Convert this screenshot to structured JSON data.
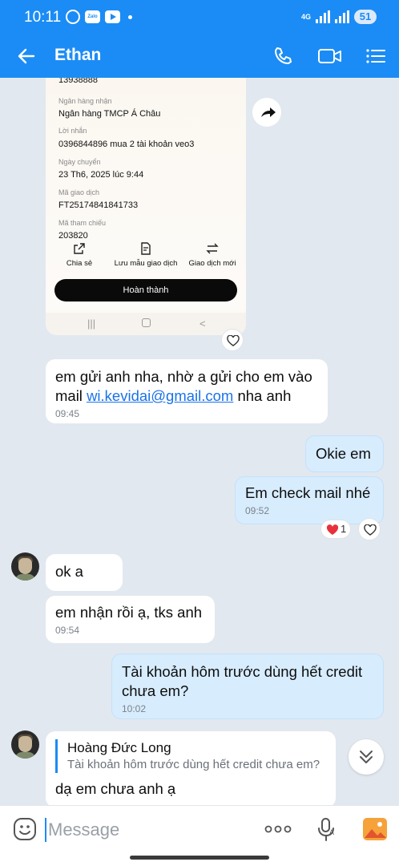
{
  "status_bar": {
    "time": "10:11",
    "zalo_badge": "Zalo",
    "network": "4G",
    "battery": "51"
  },
  "header": {
    "title": "Ethan",
    "icons": [
      "back-arrow-icon",
      "phone-icon",
      "video-call-icon",
      "menu-icon"
    ],
    "color": "#1b8cf5"
  },
  "receipt": {
    "top_value": "13938888",
    "fields": [
      {
        "label": "Ngân hàng nhận",
        "value": "Ngân hàng TMCP Á Châu"
      },
      {
        "label": "Lời nhắn",
        "value": "0396844896 mua 2 tài khoản veo3"
      },
      {
        "label": "Ngày chuyển",
        "value": "23 Th6, 2025 lúc 9:44"
      },
      {
        "label": "Mã giao dịch",
        "value": "FT25174841841733"
      },
      {
        "label": "Mã tham chiếu",
        "value": "203820"
      }
    ],
    "actions": [
      "Chia sẻ",
      "Lưu mẫu giao dịch",
      "Giao dịch mới"
    ],
    "done_button": "Hoàn thành"
  },
  "messages": [
    {
      "id": "m1",
      "direction": "in",
      "text_before": "em gửi anh nha, nhờ a gửi cho em vào mail ",
      "link": "wi.kevidai@gmail.com",
      "text_after": " nha anh",
      "time": "09:45"
    },
    {
      "id": "m2",
      "direction": "out",
      "text": "Okie em"
    },
    {
      "id": "m3",
      "direction": "out",
      "text": "Em check mail nhé",
      "time": "09:52",
      "reaction_count": "1"
    },
    {
      "id": "m4",
      "direction": "in",
      "text": "ok a"
    },
    {
      "id": "m5",
      "direction": "in",
      "text": "em nhận rồi ạ, tks anh",
      "time": "09:54"
    },
    {
      "id": "m6",
      "direction": "out",
      "text": "Tài khoản hôm trước dùng hết credit chưa em?",
      "time": "10:02"
    },
    {
      "id": "m7",
      "direction": "in",
      "quote_name": "Hoàng Đức Long",
      "quote_text": "Tài khoản hôm trước dùng hết credit chưa em?",
      "text": "dạ em chưa anh ạ"
    }
  ],
  "input": {
    "placeholder": "Message",
    "icons": [
      "emoji-icon",
      "more-icon",
      "voice-icon",
      "image-icon"
    ]
  },
  "colors": {
    "outgoing_bubble": "#d7ecfd",
    "incoming_bubble": "#ffffff",
    "background": "#e2e8ef"
  }
}
